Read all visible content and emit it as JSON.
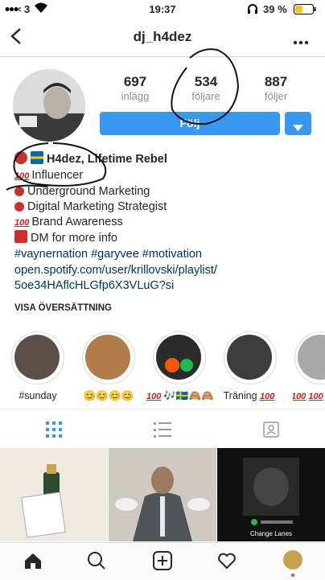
{
  "status_bar": {
    "carrier": "3",
    "time": "19:37",
    "battery": "39 %"
  },
  "header": {
    "username": "dj_h4dez"
  },
  "stats": [
    {
      "value": "697",
      "label": "inlägg"
    },
    {
      "value": "534",
      "label": "följare"
    },
    {
      "value": "887",
      "label": "följer"
    }
  ],
  "follow_label": "Följ",
  "bio": {
    "name": "H4dez, Lifetime Rebel",
    "lines": [
      "Influencer",
      "Underground Marketing",
      "Digital Marketing Strategist",
      "Brand Awareness",
      "DM for more info"
    ],
    "hashtags": "#vaynernation #garyvee #motivation",
    "link_line1": "open.spotify.com/user/krillovski/playlist/",
    "link_line2": "5oe34HAflcHLGfp6X3VLuG?si"
  },
  "translate_label": "VISA ÖVERSÄTTNING",
  "highlights": [
    {
      "label": "#sunday"
    },
    {
      "label": "😊😊😊😊"
    },
    {
      "label": "🎶🇸🇪🙈🙈"
    },
    {
      "label": "Träning"
    },
    {
      "label": ""
    }
  ],
  "posts": [
    {
      "caption": ""
    },
    {
      "caption": ""
    },
    {
      "caption": "Change Lanes"
    }
  ],
  "colors": {
    "accent": "#3897f0",
    "link": "#003569",
    "annotation": "#111111"
  }
}
